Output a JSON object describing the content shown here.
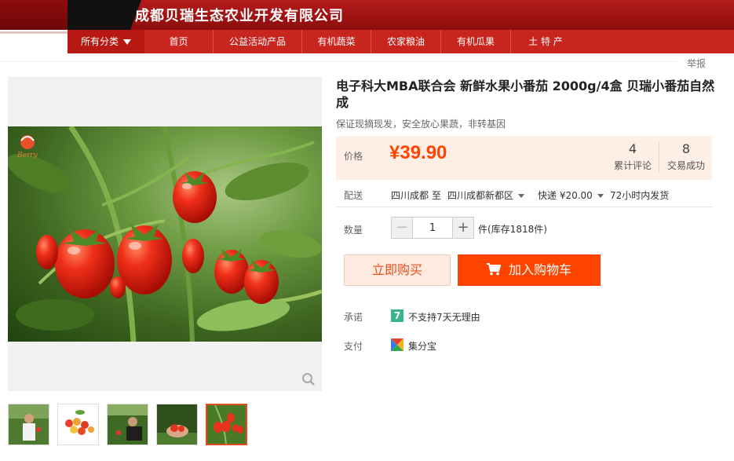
{
  "shop": {
    "name": "成都贝瑞生态农业开发有限公司"
  },
  "nav": {
    "all_categories": "所有分类",
    "items": [
      "首页",
      "公益活动产品",
      "有机蔬菜",
      "农家粮油",
      "有机瓜果",
      "土 特 产"
    ]
  },
  "report": "举报",
  "product": {
    "title": "电子科大MBA联合会 新鲜水果小番茄 2000g/4盒 贝瑞小番茄自然成",
    "subtitle": "保证现摘现发，安全放心果蔬，非转基因",
    "photo_brand": "Berry"
  },
  "price": {
    "label": "价格",
    "value": "¥39.90"
  },
  "stats": [
    {
      "num": "4",
      "label": "累计评论"
    },
    {
      "num": "8",
      "label": "交易成功"
    }
  ],
  "shipping": {
    "label": "配送",
    "from": "四川成都 至",
    "to": "四川成都新都区",
    "fee": "快递 ¥20.00",
    "time": "72小时内发货"
  },
  "quantity": {
    "label": "数量",
    "value": "1",
    "minus": "−",
    "plus": "+",
    "stock": "件(库存1818件)"
  },
  "buttons": {
    "buy_now": "立即购买",
    "add_cart": "加入购物车"
  },
  "promise": {
    "label": "承诺",
    "badge": "7",
    "text": "不支持7天无理由"
  },
  "payment": {
    "label": "支付",
    "text": "集分宝"
  },
  "colors": {
    "brand_red": "#c8251f",
    "price_orange": "#ff4400",
    "price_bg": "#fdeee6"
  },
  "icons": [
    "chevron-down-icon",
    "zoom-icon",
    "cart-icon",
    "seven-day-badge-icon",
    "jifenbao-icon"
  ]
}
